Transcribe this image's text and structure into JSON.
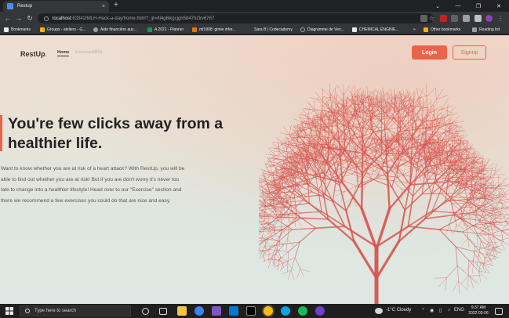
{
  "browser": {
    "tab_title": "Restup",
    "tab_close": "×",
    "new_tab": "+",
    "window_controls": [
      "⌄",
      "—",
      "❐",
      "✕"
    ],
    "url_host": "localhost",
    "url_path": ":63342/MLH-Hack-a-day/home.html?_ijt=8i4g6lkgcjgn5847h2lrv6767",
    "bookmarks": [
      "Bookmarks",
      "Groups - ateliers - G...",
      "Aide financière aux...",
      "A 2021 - Planner",
      "mf1908: gimie infor...",
      "Sara B | Codecademy",
      "Diagramme de Ven...",
      "CHEMICAL ENGINE...",
      "»",
      "Other bookmarks",
      "Reading list"
    ]
  },
  "site": {
    "brand": "RestUp",
    "brand_dot": ".",
    "nav": {
      "home": "Home",
      "exercise": "Exercise&BMI"
    },
    "login": "Login",
    "signup": "Signup",
    "hero_title": "You're few clicks away from a healthier life.",
    "hero_text": "Want to know whether you are at risk of a heart attack? With RestUp, you will be able to find out whether you are at risk! But if you are don't worry it's never too late to change into a healthier lifestyle! Head over to our \"Exercise\" section and there we recommend a few exercises you could do that are nice and easy."
  },
  "taskbar": {
    "search_placeholder": "Type here to search",
    "weather": "-1°C  Cloudy",
    "language": "ENG",
    "time": "9:37 AM",
    "date": "2022-03-06"
  },
  "colors": {
    "accent": "#e8654a",
    "coral": "#d9524d"
  }
}
